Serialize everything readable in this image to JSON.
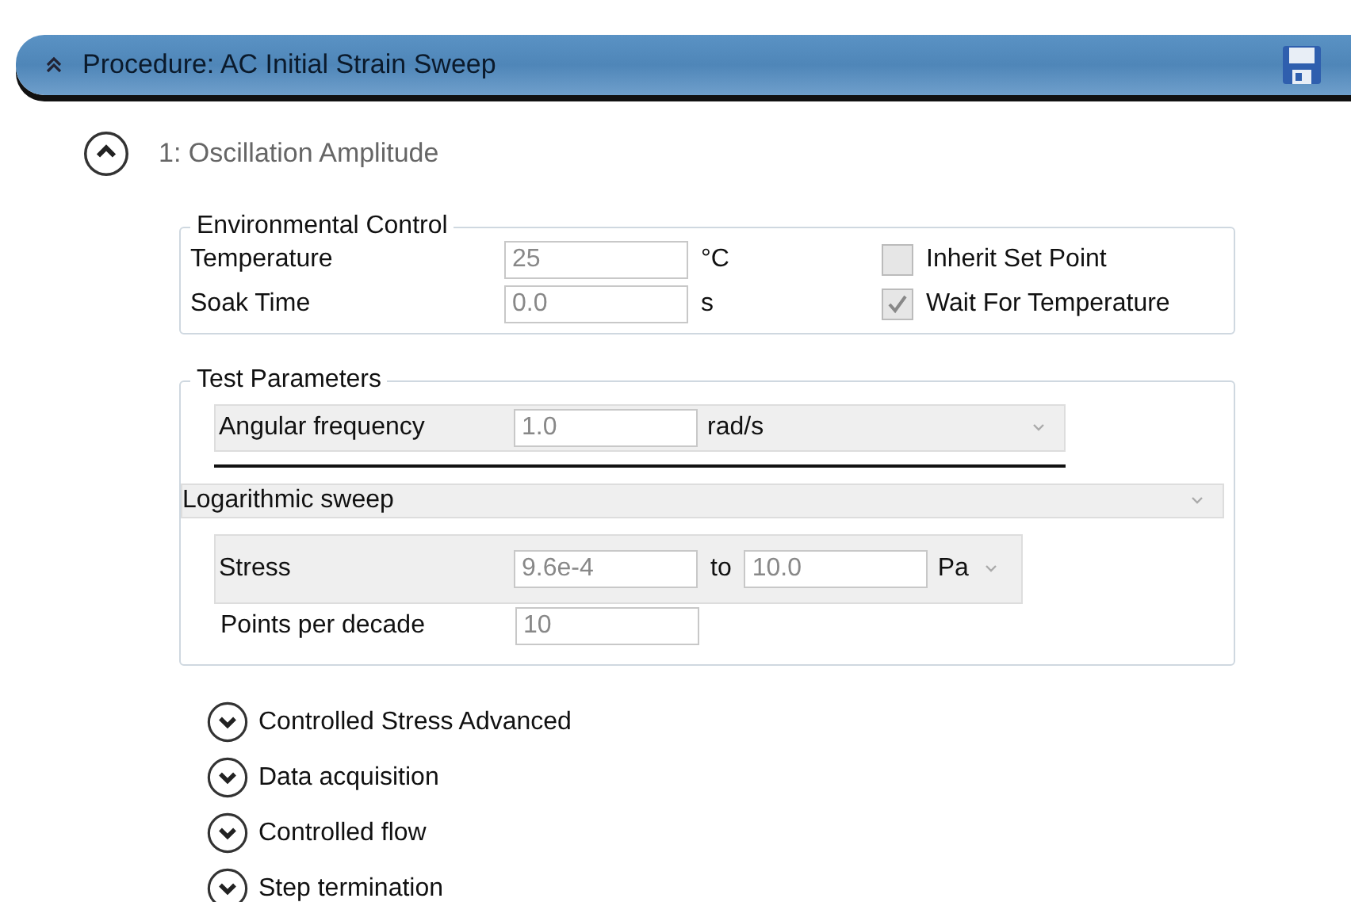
{
  "procedure": {
    "title": "Procedure: AC Initial Strain Sweep",
    "expanded": true
  },
  "step": {
    "title": "1: Oscillation Amplitude",
    "expanded": true
  },
  "environmental_control": {
    "title": "Environmental Control",
    "fields": [
      {
        "label": "Temperature",
        "value": "25",
        "unit": "°C",
        "disabled": true
      },
      {
        "label": "Soak Time",
        "value": "0.0",
        "unit": "s",
        "disabled": true
      }
    ],
    "checkboxes": [
      {
        "label": "Inherit Set Point",
        "checked": false
      },
      {
        "label": "Wait For Temperature",
        "checked": true,
        "disabled": true
      }
    ]
  },
  "test_parameters": {
    "title": "Test Parameters",
    "angular_frequency": {
      "label": "Angular frequency",
      "value": "1.0",
      "unit": "rad/s",
      "disabled": true
    },
    "sweep_mode": {
      "value": "Logarithmic sweep"
    },
    "stress": {
      "label": "Stress",
      "from": "9.6e-4",
      "to_label": "to",
      "to": "10.0",
      "unit": "Pa",
      "disabled": true
    },
    "points_per_decade": {
      "label": "Points per decade",
      "value": "10",
      "disabled": true
    }
  },
  "sections": [
    {
      "title": "Controlled Stress Advanced",
      "expanded": false
    },
    {
      "title": "Data acquisition",
      "expanded": false
    },
    {
      "title": "Controlled flow",
      "expanded": false
    },
    {
      "title": "Step termination",
      "expanded": false
    }
  ]
}
